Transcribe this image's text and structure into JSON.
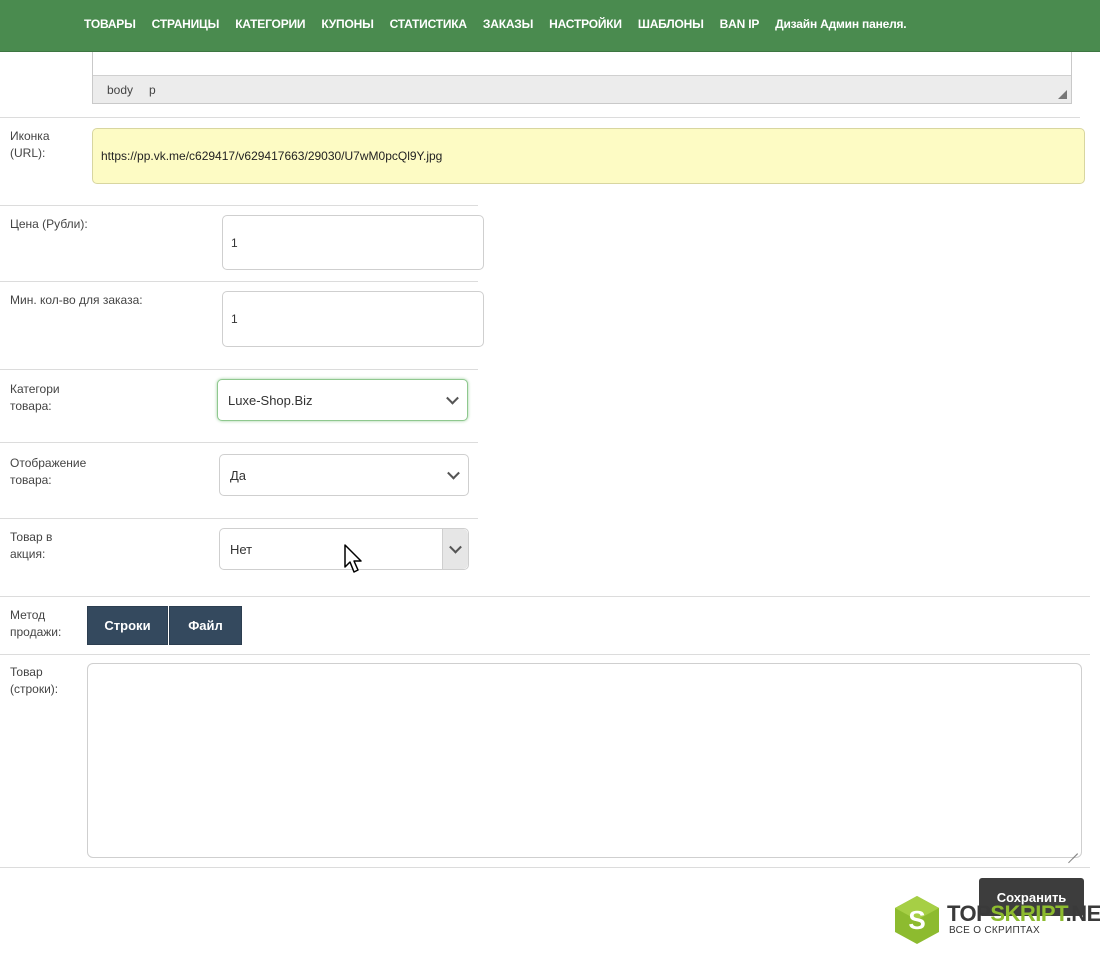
{
  "nav": {
    "items": [
      "ТОВАРЫ",
      "СТРАНИЦЫ",
      "КАТЕГОРИИ",
      "КУПОНЫ",
      "СТАТИСТИКА",
      "ЗАКАЗЫ",
      "НАСТРОЙКИ",
      "ШАБЛОНЫ",
      "BAN IP",
      "Дизайн Админ панеля."
    ],
    "bg_color": "#4a8b4f"
  },
  "editor": {
    "path_body": "body",
    "path_p": "p"
  },
  "form": {
    "icon": {
      "label_line1": "Иконка",
      "label_line2": "(URL):",
      "value": "https://pp.vk.me/c629417/v629417663/29030/U7wM0pcQl9Y.jpg"
    },
    "price": {
      "label": "Цена (Рубли):",
      "value": "1"
    },
    "min_qty": {
      "label": "Мин. кол-во для заказа:",
      "value": "1"
    },
    "category": {
      "label_line1": "Категори",
      "label_line2": "товара:",
      "selected": "Luxe-Shop.Biz"
    },
    "display": {
      "label_line1": "Отображение",
      "label_line2": "товара:",
      "selected": "Да"
    },
    "promo": {
      "label_line1": "Товар в",
      "label_line2": "акция:",
      "selected": "Нет"
    },
    "sale_method": {
      "label_line1": "Метод",
      "label_line2": "продажи:",
      "btn_lines": "Строки",
      "btn_file": "Файл"
    },
    "goods_lines": {
      "label_line1": "Товар",
      "label_line2": "(строки):",
      "value": ""
    },
    "save_label": "Сохранить"
  },
  "watermark": {
    "name_part1": "TOP",
    "name_part2": "SKRIPT",
    "name_part3": ".NET",
    "tagline": "ВСЕ О СКРИПТАХ",
    "logo_letter": "S",
    "accent_color": "#8dbb2f"
  }
}
